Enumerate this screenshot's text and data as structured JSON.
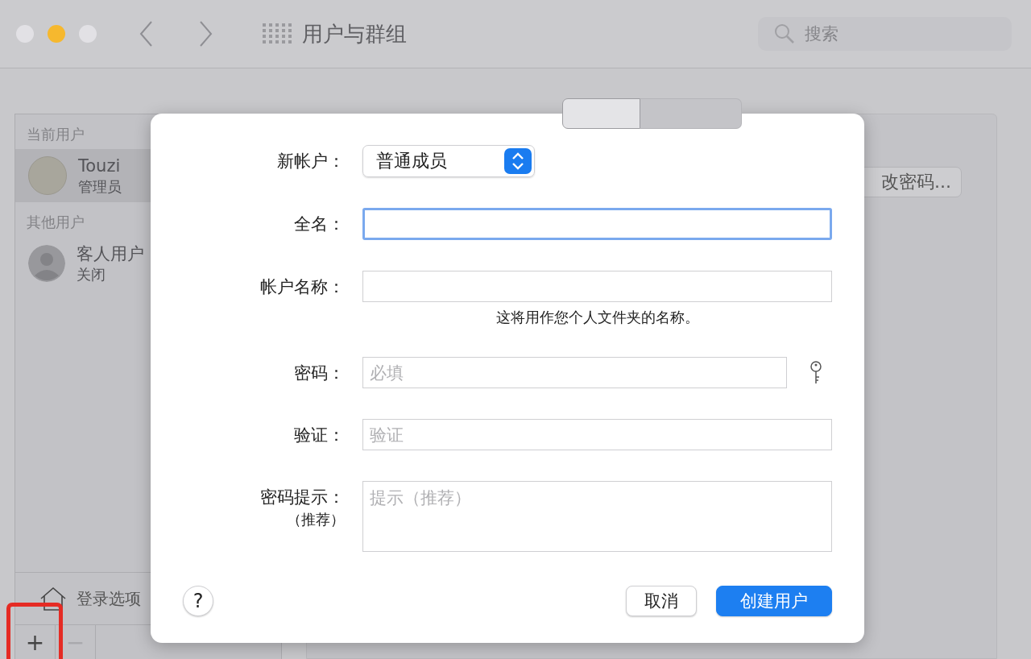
{
  "window": {
    "title": "用户与群组",
    "search": {
      "placeholder": "搜索"
    }
  },
  "sidebar": {
    "sections": [
      {
        "heading": "当前用户",
        "users": [
          {
            "name": "Touzi",
            "role": "管理员",
            "selected": true,
            "kind": "photo"
          }
        ]
      },
      {
        "heading": "其他用户",
        "users": [
          {
            "name": "客人用户",
            "role": "关闭",
            "selected": false,
            "kind": "generic"
          }
        ]
      }
    ],
    "login_options": "登录选项",
    "buttons": [
      {
        "label": "+",
        "disabled": false
      },
      {
        "label": "−",
        "disabled": true
      }
    ]
  },
  "tabs": [
    {
      "selected": true
    },
    {
      "selected": false
    }
  ],
  "change_password_button": "改密码...",
  "dialog": {
    "fields": [
      {
        "kind": "popup",
        "label": "新帐户：",
        "value": "普通成员"
      },
      {
        "kind": "text",
        "label": "全名：",
        "focused": true
      },
      {
        "kind": "text",
        "label": "帐户名称：",
        "focused": false,
        "note": "这将用作您个人文件夹的名称。"
      },
      {
        "kind": "password",
        "label": "密码：",
        "placeholder": "必填",
        "focused": false
      },
      {
        "kind": "text",
        "label": "验证：",
        "placeholder": "验证",
        "focused": false
      },
      {
        "kind": "textarea",
        "label": "密码提示：",
        "sublabel": "（推荐）",
        "placeholder": "提示（推荐）"
      }
    ],
    "help": "?",
    "buttons": [
      {
        "label": "取消",
        "default": false
      },
      {
        "label": "创建用户",
        "default": true
      }
    ]
  }
}
